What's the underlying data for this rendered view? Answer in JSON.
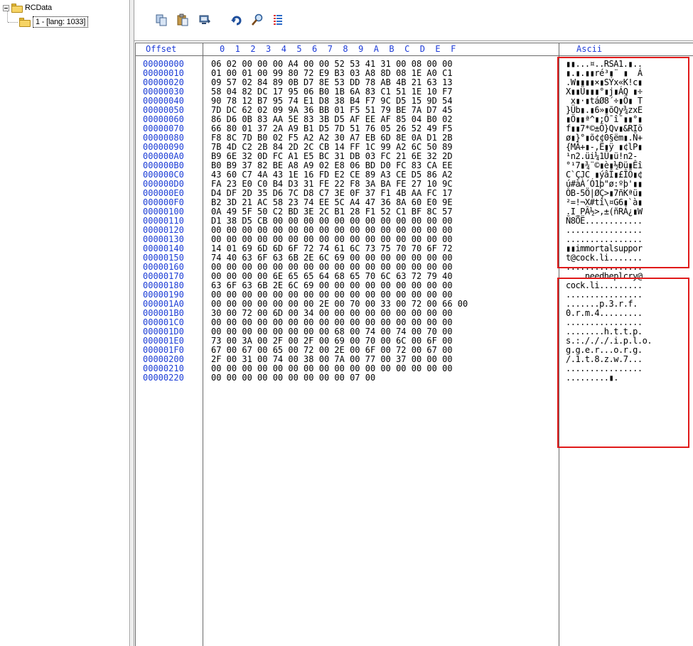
{
  "tree": {
    "root_label": "RCData",
    "child_label": "1 - [lang: 1033]"
  },
  "toolbar": {
    "buttons": [
      "copy-icon",
      "paste-icon",
      "import-icon",
      "refresh-icon",
      "find-icon",
      "stats-icon"
    ]
  },
  "header": {
    "offset": "Offset",
    "hex_cols": "0  1  2  3  4  5  6  7  8  9  A  B  C  D  E  F",
    "ascii": "Ascii"
  },
  "offsets": [
    "00000000",
    "00000010",
    "00000020",
    "00000030",
    "00000040",
    "00000050",
    "00000060",
    "00000070",
    "00000080",
    "00000090",
    "000000A0",
    "000000B0",
    "000000C0",
    "000000D0",
    "000000E0",
    "000000F0",
    "00000100",
    "00000110",
    "00000120",
    "00000130",
    "00000140",
    "00000150",
    "00000160",
    "00000170",
    "00000180",
    "00000190",
    "000001A0",
    "000001B0",
    "000001C0",
    "000001D0",
    "000001E0",
    "000001F0",
    "00000200",
    "00000210",
    "00000220"
  ],
  "hex": [
    "06 02 00 00 00 A4 00 00 52 53 41 31 00 08 00 00",
    "01 00 01 00 99 80 72 E9 B3 03 A8 8D 08 1E A0 C1",
    "09 57 02 84 89 0B D7 8E 53 DD 78 AB 4B 21 63 13",
    "58 04 82 DC 17 95 06 B0 1B 6A 83 C1 51 1E 10 F7",
    "90 78 12 B7 95 74 E1 D8 38 B4 F7 9C D5 15 9D 54",
    "7D DC 62 02 09 9A 36 BB 01 F5 51 79 BE 7A D7 45",
    "86 D6 0B 83 AA 5E 83 3B D5 AF EE AF 85 04 B0 02",
    "66 80 01 37 2A A9 B1 D5 7D 51 76 05 26 52 49 F5",
    "F8 8C 7D B0 02 F5 A2 A2 30 A7 EB 6D 8E 0A D1 2B",
    "7B 4D C2 2B 84 2D 2C CB 14 FF 1C 99 A2 6C 50 89",
    "B9 6E 32 0D FC A1 E5 BC 31 DB 03 FC 21 6E 32 2D",
    "B0 B9 37 82 BE A8 A9 02 E8 06 BD D0 FC 83 CA EE",
    "43 60 C7 4A 43 1E 16 FD E2 CE 89 A3 CE D5 86 A2",
    "FA 23 E0 C0 B4 D3 31 FE 22 F8 3A BA FE 27 10 9C",
    "D4 DF 2D 35 D6 7C D8 C7 3E 0F 37 F1 4B AA FC 17",
    "B2 3D 21 AC 58 23 74 EE 5C A4 47 36 8A 60 E0 9E",
    "0A 49 5F 50 C2 BD 3E 2C B1 28 F1 52 C1 BF 8C 57",
    "D1 38 D5 CB 00 00 00 00 00 00 00 00 00 00 00 00",
    "00 00 00 00 00 00 00 00 00 00 00 00 00 00 00 00",
    "00 00 00 00 00 00 00 00 00 00 00 00 00 00 00 00",
    "14 01 69 6D 6D 6F 72 74 61 6C 73 75 70 70 6F 72",
    "74 40 63 6F 63 6B 2E 6C 69 00 00 00 00 00 00 00",
    "00 00 00 00 00 00 00 00 00 00 00 00 00 00 00 00",
    "00 00 00 00 6E 65 65 64 68 65 70 6C 63 72 79 40",
    "63 6F 63 6B 2E 6C 69 00 00 00 00 00 00 00 00 00",
    "00 00 00 00 00 00 00 00 00 00 00 00 00 00 00 00",
    "00 00 00 00 00 00 00 2E 00 70 00 33 00 72 00 66 00",
    "30 00 72 00 6D 00 34 00 00 00 00 00 00 00 00 00",
    "00 00 00 00 00 00 00 00 00 00 00 00 00 00 00 00",
    "00 00 00 00 00 00 00 00 68 00 74 00 74 00 70 00",
    "73 00 3A 00 2F 00 2F 00 69 00 70 00 6C 00 6F 00",
    "67 00 67 00 65 00 72 00 2E 00 6F 00 72 00 67 00",
    "2F 00 31 00 74 00 38 00 7A 00 77 00 37 00 00 00",
    "00 00 00 00 00 00 00 00 00 00 00 00 00 00 00 00",
    "00 00 00 00 00 00 00 00 00 07 00"
  ],
  "ascii": [
    "▮▮...¤..RSA1.▮..",
    "▮.▮.▮▮ré³▮¨ ▮  Á",
    ".W▮▮▮▮×▮SÝx«K!c▮",
    "X▮▮Ü▮▮▮°▮j▮ÁQ ▮÷",
    " x▮·▮táØ8´÷▮Õ▮ T",
    "}Üb▮.▮6»▮õQy¾zxE",
    "▮Ö▮▮ª^▮;Õ¯î¯▮▮°▮",
    "f▮▮7*©±Õ}Qv▮&RIõ",
    "ø▮}°▮õ¢¢0§ëm▮.Ñ+",
    "{MÂ+▮-,Ë▮ÿ ▮¢lP▮",
    "¹n2.üi¼1Û▮ü!n2-",
    "°¹7▮¾¨©▮è▮½Ðü▮Êî",
    "C`ÇJC ▮ýâÎ▮£ÎÕ▮¢",
    "ú#àÀ´Ó1þ\"ø:ºþ'▮▮",
    "ÔB-5Ö|ØÇ>▮7ñKªü▮",
    "²=!¬X#tî\\¤G6▮`à▮",
    ".I_PÂ½>,±(ñRÁ¿▮W",
    "Ñ8ÕË............",
    "................",
    "................",
    "▮▮immortalsuppor",
    "t@cock.li.......",
    "................",
    "....needheplcry@",
    "cock.li.........",
    "................",
    ".......p.3.r.f.",
    "0.r.m.4.........",
    "................",
    "........h.t.t.p.",
    "s.:./././.i.p.l.o.",
    "g.g.e.r...o.r.g.",
    "/.1.t.8.z.w.7...",
    "................",
    ".........▮."
  ],
  "colors": {
    "highlight_box": "#e01a1a",
    "offset_text": "#1a3cd6"
  }
}
